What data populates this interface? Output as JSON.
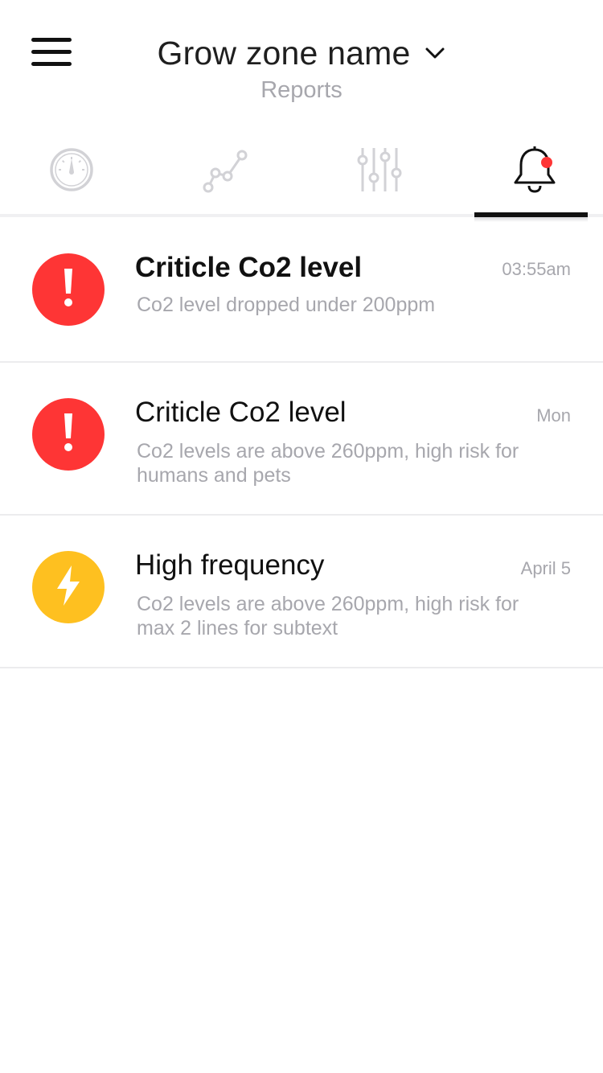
{
  "header": {
    "zone_name": "Grow zone name",
    "subtitle": "Reports"
  },
  "tabs": [
    {
      "name": "dashboard",
      "icon": "gauge-icon",
      "active": false
    },
    {
      "name": "charts",
      "icon": "line-graph-icon",
      "active": false
    },
    {
      "name": "controls",
      "icon": "sliders-icon",
      "active": false
    },
    {
      "name": "notifications",
      "icon": "bell-icon",
      "active": true,
      "badge": true
    }
  ],
  "notifications": [
    {
      "title": "Criticle Co2 level",
      "time": "03:55am",
      "text": "Co2 level dropped under 200ppm",
      "icon": "exclamation-icon",
      "color": "#fe3535",
      "unread": true
    },
    {
      "title": "Criticle Co2 level",
      "time": "Mon",
      "text": "Co2 levels are above 260ppm, high risk for humans and pets",
      "icon": "exclamation-icon",
      "color": "#fe3535",
      "unread": false
    },
    {
      "title": "High frequency",
      "time": "April 5",
      "text": "Co2 levels are above 260ppm, high risk for max 2 lines for subtext",
      "icon": "lightning-icon",
      "color": "#fec020",
      "unread": false
    }
  ],
  "colors": {
    "alert_red": "#fe3535",
    "warning_yellow": "#fec020",
    "badge_red": "#fe3535",
    "muted_text": "#a7a7ad",
    "active_tab": "#111111",
    "inactive_icon": "#d2d2d6"
  }
}
